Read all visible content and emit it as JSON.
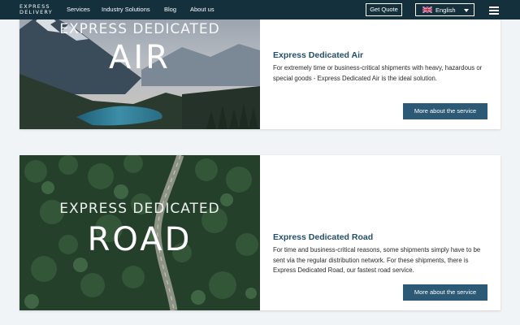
{
  "nav": {
    "logo_line1": "EXPRESS",
    "logo_line2": "DELIVERY",
    "links": [
      "Services",
      "Industry Solutions",
      "Blog",
      "About us"
    ],
    "quote_label": "Get Quote",
    "language": "English"
  },
  "cards": [
    {
      "image_small_text": "EXPRESS DEDICATED",
      "image_big_text": "AIR",
      "title": "Express Dedicated Air",
      "description": "For extremely time or business-critical shipments with heavy, hazardous or special goods - Express Dedicated Air is the ideal solution.",
      "button_label": "More about the service"
    },
    {
      "image_small_text": "EXPRESS DEDICATED",
      "image_big_text": "ROAD",
      "title": "Express Dedicated Road",
      "description": "For time and business-critical reasons, some shipments simply have to be sent via the regular distribution network. For these shipments, there is Express Dedicated Road, our fastest road service.",
      "button_label": "More about the service"
    }
  ],
  "colors": {
    "navbar": "#14303d",
    "title": "#1f4f6b",
    "button": "#2c5a76",
    "page_bg": "#f1f4f6"
  }
}
